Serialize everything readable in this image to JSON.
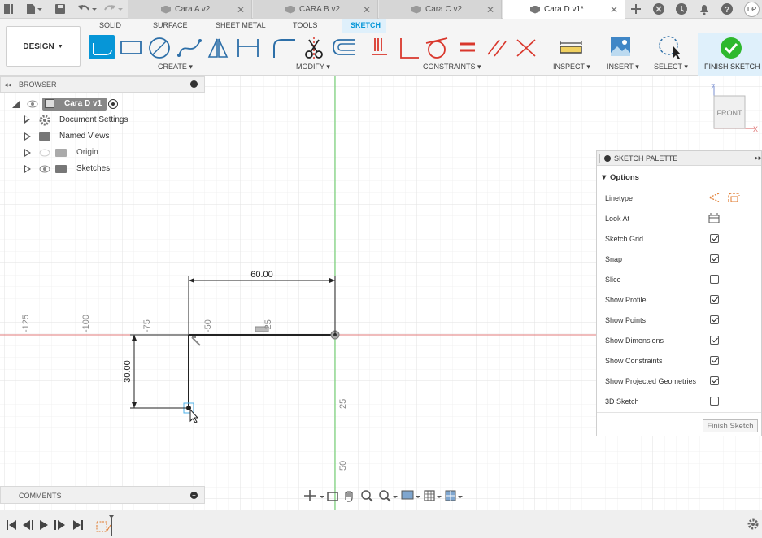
{
  "tabs": [
    {
      "label": "Cara A v2"
    },
    {
      "label": "CARA B v2"
    },
    {
      "label": "Cara C v2"
    },
    {
      "label": "Cara D v1*"
    }
  ],
  "user_initials": "DP",
  "workspace": "DESIGN",
  "ribbon_tabs": [
    "SOLID",
    "SURFACE",
    "SHEET METAL",
    "TOOLS",
    "SKETCH"
  ],
  "groups": {
    "create": "CREATE",
    "modify": "MODIFY",
    "constraints": "CONSTRAINTS",
    "inspect": "INSPECT",
    "insert": "INSERT",
    "select": "SELECT",
    "finish": "FINISH SKETCH"
  },
  "browser": {
    "title": "BROWSER",
    "root": "Cara D v1",
    "items": [
      "Document Settings",
      "Named Views",
      "Origin",
      "Sketches"
    ]
  },
  "view_cube": {
    "face": "FRONT",
    "axis_z": "Z",
    "axis_x": "X"
  },
  "dimensions": {
    "horizontal": "60.00",
    "vertical": "30.00"
  },
  "ruler": {
    "h_ticks": [
      "-125",
      "-100",
      "-75",
      "-50",
      "-25"
    ],
    "v_ticks": [
      "25",
      "50"
    ]
  },
  "palette": {
    "title": "SKETCH PALETTE",
    "section": "Options",
    "rows": [
      {
        "label": "Linetype",
        "type": "icons"
      },
      {
        "label": "Look At",
        "type": "icon"
      },
      {
        "label": "Sketch Grid",
        "checked": true
      },
      {
        "label": "Snap",
        "checked": true
      },
      {
        "label": "Slice",
        "checked": false
      },
      {
        "label": "Show Profile",
        "checked": true
      },
      {
        "label": "Show Points",
        "checked": true
      },
      {
        "label": "Show Dimensions",
        "checked": true
      },
      {
        "label": "Show Constraints",
        "checked": true
      },
      {
        "label": "Show Projected Geometries",
        "checked": true
      },
      {
        "label": "3D Sketch",
        "checked": false
      }
    ],
    "finish_label": "Finish Sketch"
  },
  "comments": {
    "title": "COMMENTS"
  },
  "colors": {
    "accent": "#0696d7",
    "finish_green": "#2eb82e",
    "constraint_red": "#d9372c",
    "axis_green": "#5cc85c",
    "axis_red": "#e07a7a"
  }
}
